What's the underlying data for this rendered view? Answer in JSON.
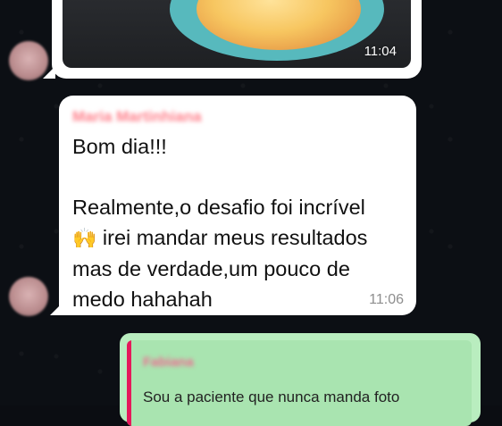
{
  "image_message": {
    "time": "11:04"
  },
  "text_message": {
    "sender": "Maria Martinhiana",
    "line1": "Bom dia!!!",
    "line2a": "Realmente,o desafio foi incrível",
    "emoji": "🙌",
    "line2b": " irei mandar meus resultados\nmas de verdade,um pouco de\nmedo hahahah",
    "time": "11:06"
  },
  "reply_message": {
    "quoted_sender": "Fabiana",
    "quoted_text": "Sou a paciente que nunca manda foto"
  },
  "colors": {
    "incoming_bubble": "#ffffff",
    "outgoing_bubble": "#b9edbf",
    "quote_accent": "#e5195b",
    "sender_name": "#ff7f8a"
  }
}
